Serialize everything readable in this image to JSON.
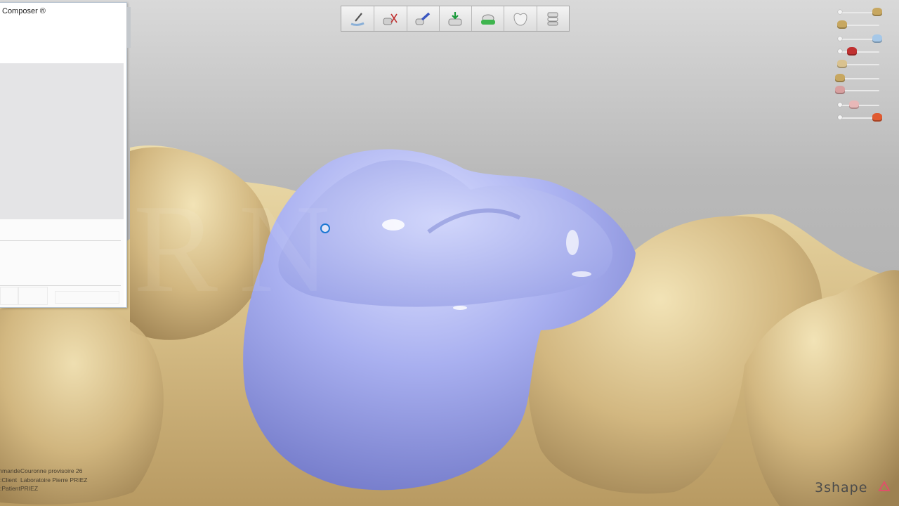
{
  "app": {
    "panel_title": "Composer ®",
    "logo_text": "3shape"
  },
  "toolbar": {
    "tools": [
      {
        "name": "sculpt-tool-icon"
      },
      {
        "name": "cut-tool-icon"
      },
      {
        "name": "connect-tool-icon"
      },
      {
        "name": "place-tool-icon"
      },
      {
        "name": "margin-tool-icon"
      },
      {
        "name": "crown-tool-icon"
      },
      {
        "name": "stack-tool-icon"
      }
    ]
  },
  "order_info": {
    "rows": [
      {
        "label": "Commande:",
        "value": "Couronne provisoire 26"
      },
      {
        "label": "Client:",
        "value": "Laboratoire Pierre PRIEZ"
      },
      {
        "label": "Patient:",
        "value": "PRIEZ"
      }
    ]
  },
  "visibility_sliders": [
    {
      "name": "upper-model-visibility",
      "level": 0.95
    },
    {
      "name": "lower-model-visibility",
      "level": 0.05
    },
    {
      "name": "crown-visibility",
      "level": 0.95
    },
    {
      "name": "cutout-visibility",
      "level": 0.3
    },
    {
      "name": "antagonist-visibility",
      "level": 0.05
    },
    {
      "name": "preparation-visibility",
      "level": 0
    },
    {
      "name": "gingiva-visibility",
      "level": 0
    },
    {
      "name": "neighbor-teeth-visibility",
      "level": 0.35
    },
    {
      "name": "margin-line-visibility",
      "level": 0.95
    }
  ],
  "colors": {
    "model": "#d9c28f",
    "crown": "#a6acef",
    "background": "#b4b4b4",
    "accent": "#1b77d2"
  }
}
